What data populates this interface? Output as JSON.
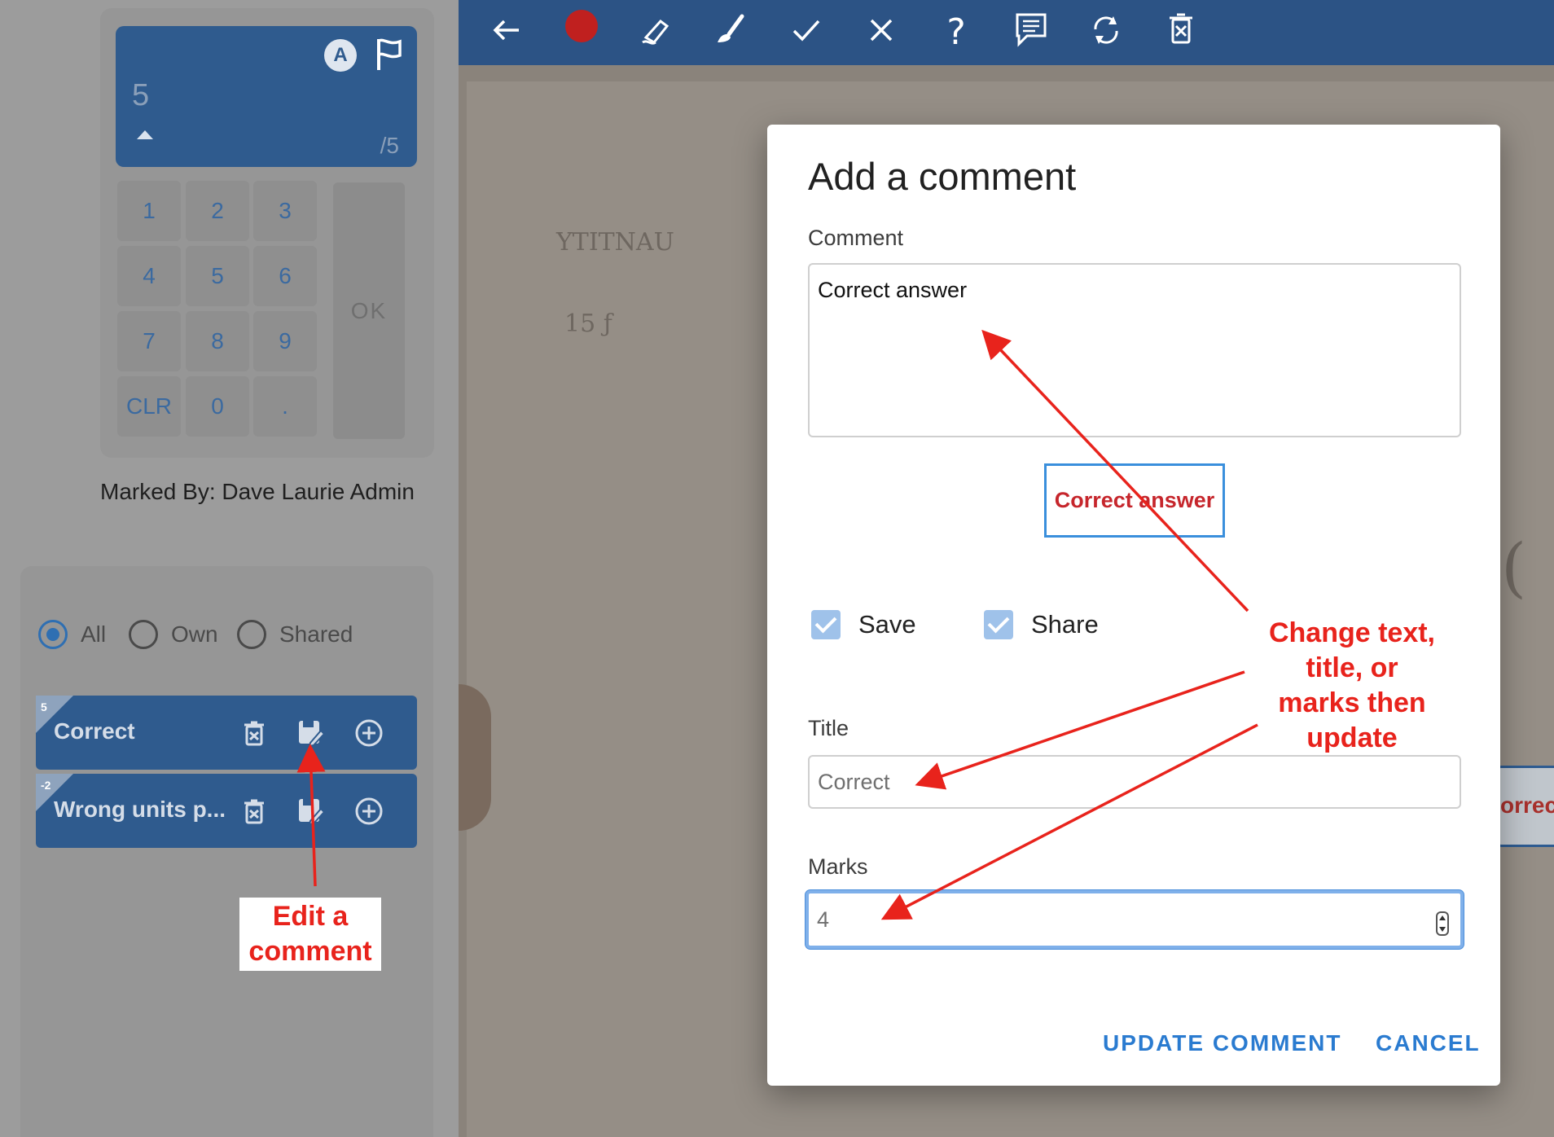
{
  "score_panel": {
    "value": "5",
    "out_of": "/5",
    "badge": "A",
    "keys": [
      "1",
      "2",
      "3",
      "4",
      "5",
      "6",
      "7",
      "8",
      "9",
      "CLR",
      "0",
      "."
    ],
    "ok_label": "OK",
    "marked_by": "Marked By: Dave Laurie Admin"
  },
  "filters": {
    "selected": "All",
    "options": [
      "All",
      "Own",
      "Shared"
    ]
  },
  "saved_comments": [
    {
      "marks": "5",
      "title": "Correct"
    },
    {
      "marks": "-2",
      "title": "Wrong units p..."
    }
  ],
  "toolbar": {
    "icons": [
      "back-arrow-icon",
      "red-dot-icon",
      "eraser-icon",
      "brush-icon",
      "tick-icon",
      "cross-icon",
      "question-icon",
      "comment-icon",
      "rotate-icon",
      "delete-icon"
    ],
    "accent": "#2c5385"
  },
  "dialog": {
    "title": "Add a comment",
    "comment_label": "Comment",
    "comment_value": "Correct answer",
    "preview_text": "Correct answer",
    "save_label": "Save",
    "share_label": "Share",
    "title_label": "Title",
    "title_value": "Correct",
    "marks_label": "Marks",
    "marks_value": "4",
    "update_button": "UPDATE COMMENT",
    "cancel_button": "CANCEL"
  },
  "document": {
    "visible_fragment": "orrect"
  },
  "annotations": {
    "edit_callout": [
      "Edit a",
      "comment"
    ],
    "change_callout": [
      "Change text,",
      "title, or",
      "marks then",
      "update"
    ],
    "arrow_color": "#e8231c"
  }
}
